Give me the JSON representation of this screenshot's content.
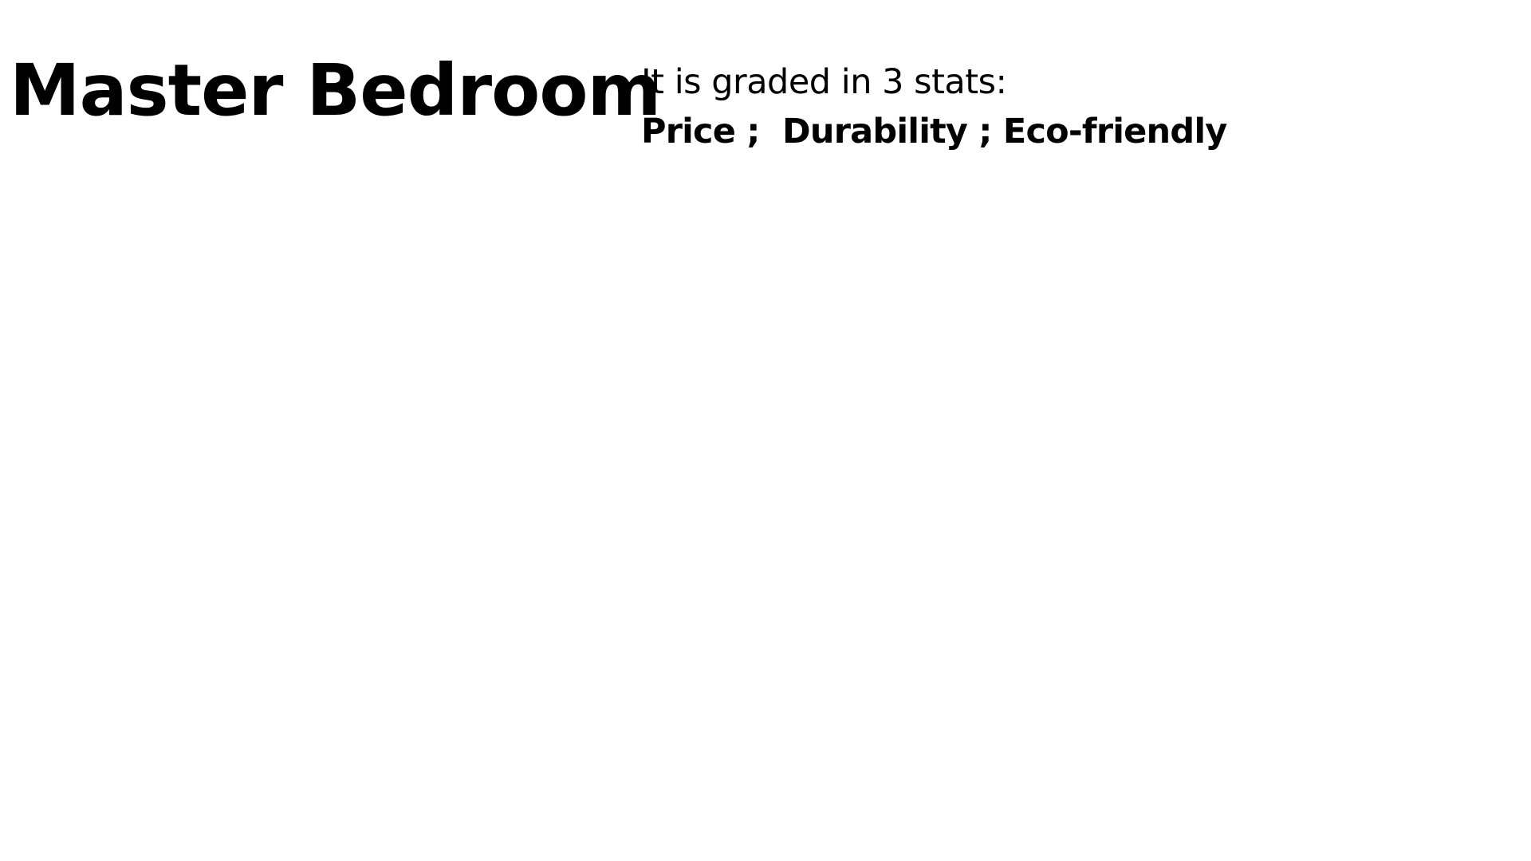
{
  "slide": {
    "title": "Master Bedroom",
    "intro": "It is graded in 3 stats:",
    "stats": "Price ;  Durability ; Eco-friendly"
  }
}
